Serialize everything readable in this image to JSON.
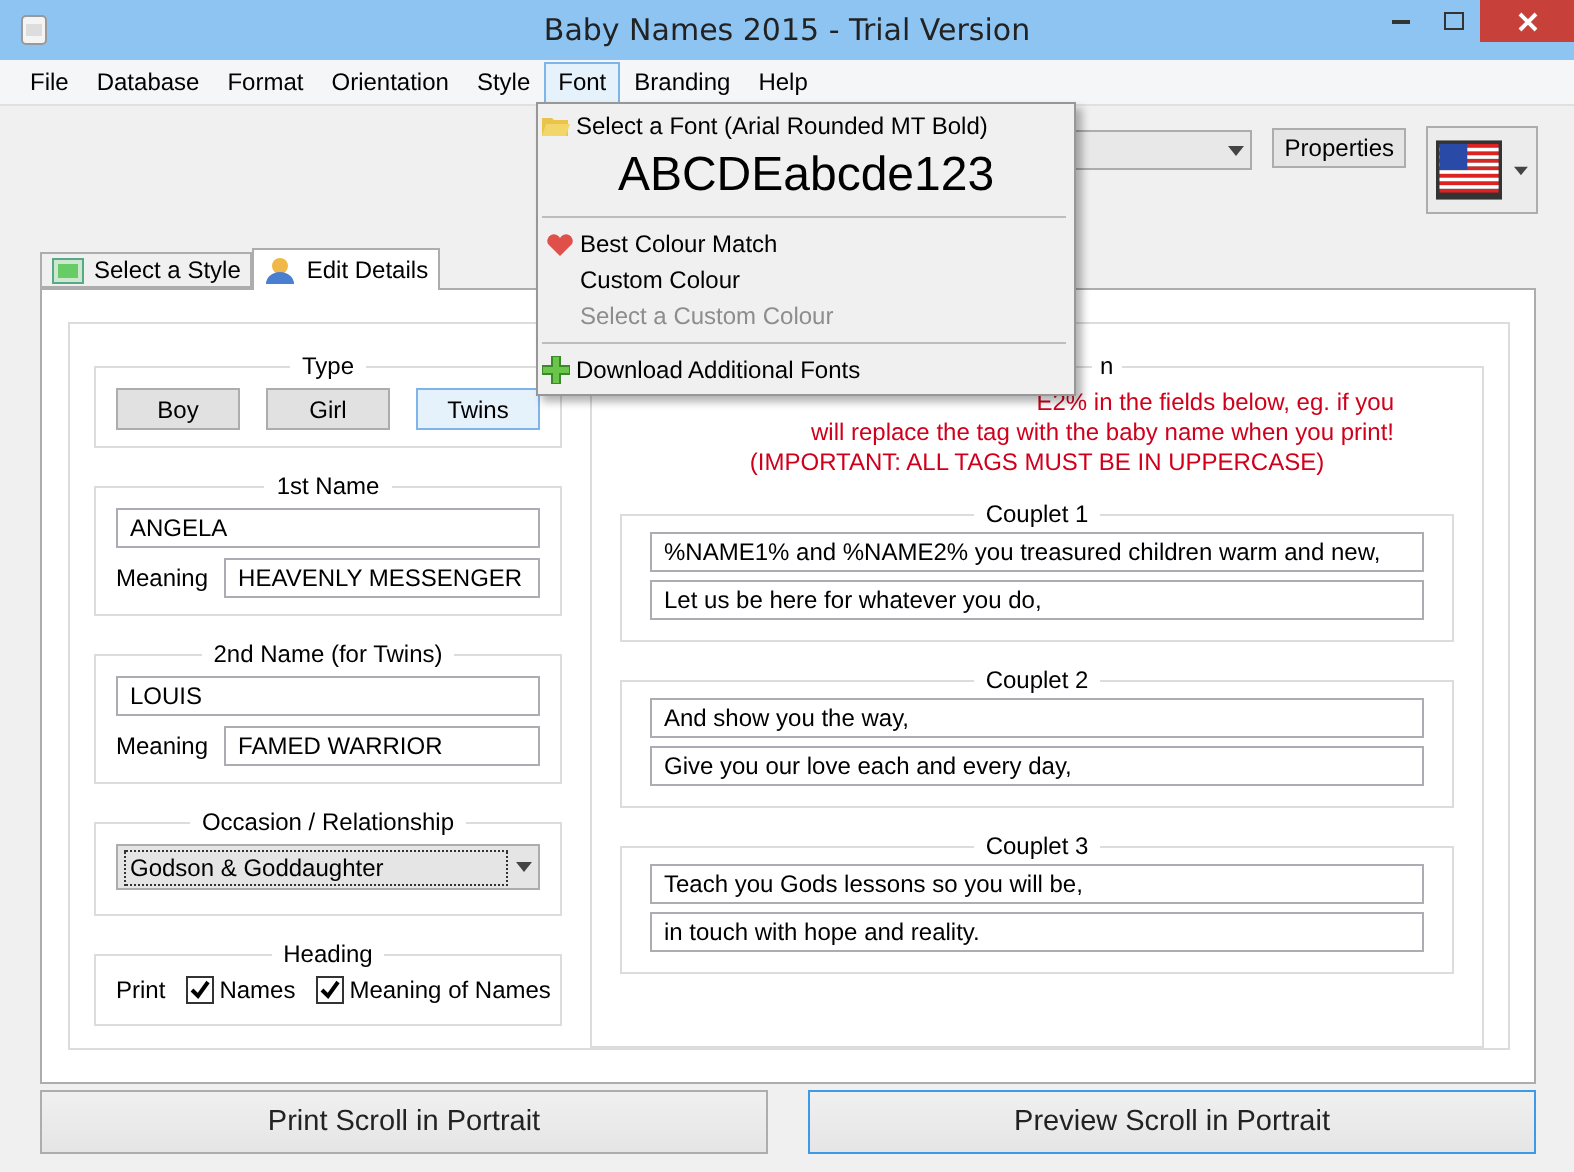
{
  "window": {
    "title": "Baby Names 2015 - Trial Version"
  },
  "menu_bar": [
    {
      "label": "File",
      "selected": false
    },
    {
      "label": "Database",
      "selected": false
    },
    {
      "label": "Format",
      "selected": false
    },
    {
      "label": "Orientation",
      "selected": false
    },
    {
      "label": "Style",
      "selected": false
    },
    {
      "label": "Font",
      "selected": true
    },
    {
      "label": "Branding",
      "selected": false
    },
    {
      "label": "Help",
      "selected": false
    }
  ],
  "font_menu": [
    {
      "kind": "font",
      "label": "Select a Font (Arial Rounded MT Bold)"
    },
    {
      "kind": "sample",
      "label": "ABCDEabcde123"
    },
    {
      "kind": "separator"
    },
    {
      "kind": "option",
      "label": "Best Colour Match",
      "checked": true,
      "disabled": false
    },
    {
      "kind": "option",
      "label": "Custom Colour",
      "checked": false,
      "disabled": false
    },
    {
      "kind": "option",
      "label": "Select a Custom Colour",
      "checked": false,
      "disabled": true
    },
    {
      "kind": "separator"
    },
    {
      "kind": "download",
      "label": "Download Additional Fonts"
    }
  ],
  "toolbar": {
    "properties_button": "Properties"
  },
  "tabs": [
    {
      "label": "Select a Style",
      "selected": false
    },
    {
      "label": "Edit Details",
      "selected": true
    }
  ],
  "type_group": {
    "title": "Type",
    "buttons": [
      {
        "label": "Boy",
        "selected": false
      },
      {
        "label": "Girl",
        "selected": false
      },
      {
        "label": "Twins",
        "selected": true
      }
    ]
  },
  "name_groups": [
    {
      "title": "1st Name",
      "name": "ANGELA",
      "meaning_label": "Meaning",
      "meaning": "HEAVENLY MESSENGER"
    },
    {
      "title": "2nd Name (for Twins)",
      "name": "LOUIS",
      "meaning_label": "Meaning",
      "meaning": "FAMED WARRIOR"
    }
  ],
  "occasion": {
    "title": "Occasion / Relationship",
    "value": "Godson & Goddaughter"
  },
  "heading": {
    "title": "Heading",
    "print_label": "Print",
    "options": [
      {
        "label": "Names",
        "checked": true
      },
      {
        "label": "Meaning of Names",
        "checked": true
      }
    ]
  },
  "verse": {
    "title": "n",
    "instructions": [
      "E2% in the fields below, eg. if you",
      "will replace the tag with the baby name when you print!",
      "(IMPORTANT: ALL TAGS MUST BE IN UPPERCASE)"
    ],
    "couplets": [
      {
        "title": "Couplet 1",
        "lines": [
          "%NAME1% and %NAME2% you treasured children warm and new,",
          "Let us be here for whatever you do,"
        ]
      },
      {
        "title": "Couplet 2",
        "lines": [
          "And show you the way,",
          "Give you our love each and every day,"
        ]
      },
      {
        "title": "Couplet 3",
        "lines": [
          "Teach you Gods lessons so you will be,",
          "in touch with hope and reality."
        ]
      }
    ]
  },
  "buttons": [
    {
      "label": "Print Scroll in Portrait",
      "selected": false
    },
    {
      "label": "Preview Scroll in Portrait",
      "selected": true
    }
  ]
}
